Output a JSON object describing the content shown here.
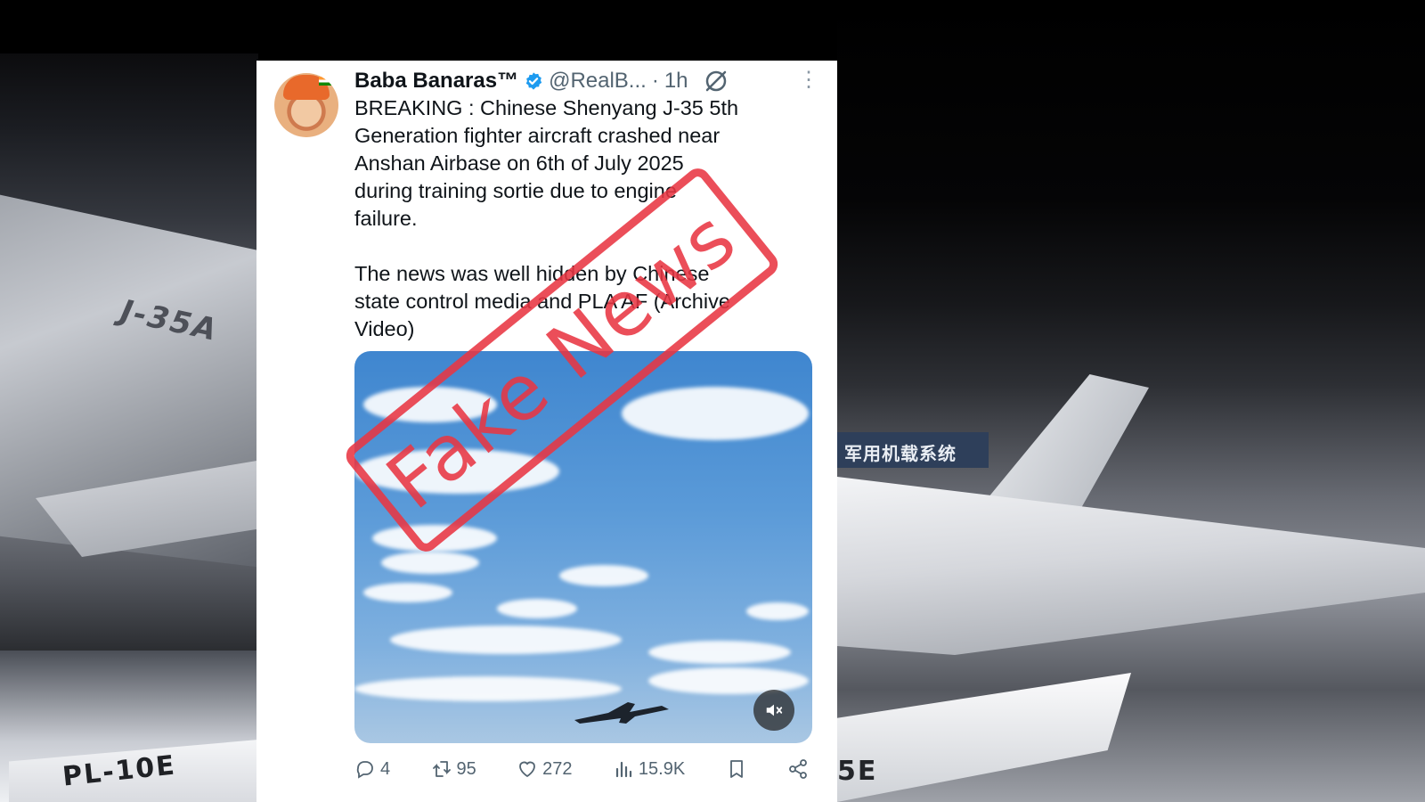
{
  "background": {
    "left_labels": [
      "J-35A",
      "PL-10E"
    ],
    "right_labels": [
      "军用机载系统",
      "5E"
    ]
  },
  "tweet": {
    "display_name": "Baba Banaras™",
    "handle": "@RealB...",
    "separator": "·",
    "time": "1h",
    "paragraphs": [
      "BREAKING : Chinese Shenyang J-35 5th\nGeneration fighter aircraft crashed near\nAnshan Airbase on 6th of July 2025\nduring training sortie due to engine\nfailure.",
      "The news was well hidden by Chinese\nstate control media and PLA AF (Archive\nVideo)"
    ],
    "stats": {
      "replies": "4",
      "reposts": "95",
      "likes": "272",
      "views": "15.9K"
    }
  },
  "stamp": {
    "text": "Fake News",
    "color": "#e83642"
  },
  "colors": {
    "verified": "#1d9bf0",
    "secondary_text": "#536471",
    "primary_text": "#0f1419"
  },
  "icons": [
    "verified-badge-icon",
    "grok-icon",
    "more-icon",
    "mute-icon",
    "reply-icon",
    "repost-icon",
    "like-icon",
    "views-icon",
    "bookmark-icon",
    "share-icon"
  ]
}
